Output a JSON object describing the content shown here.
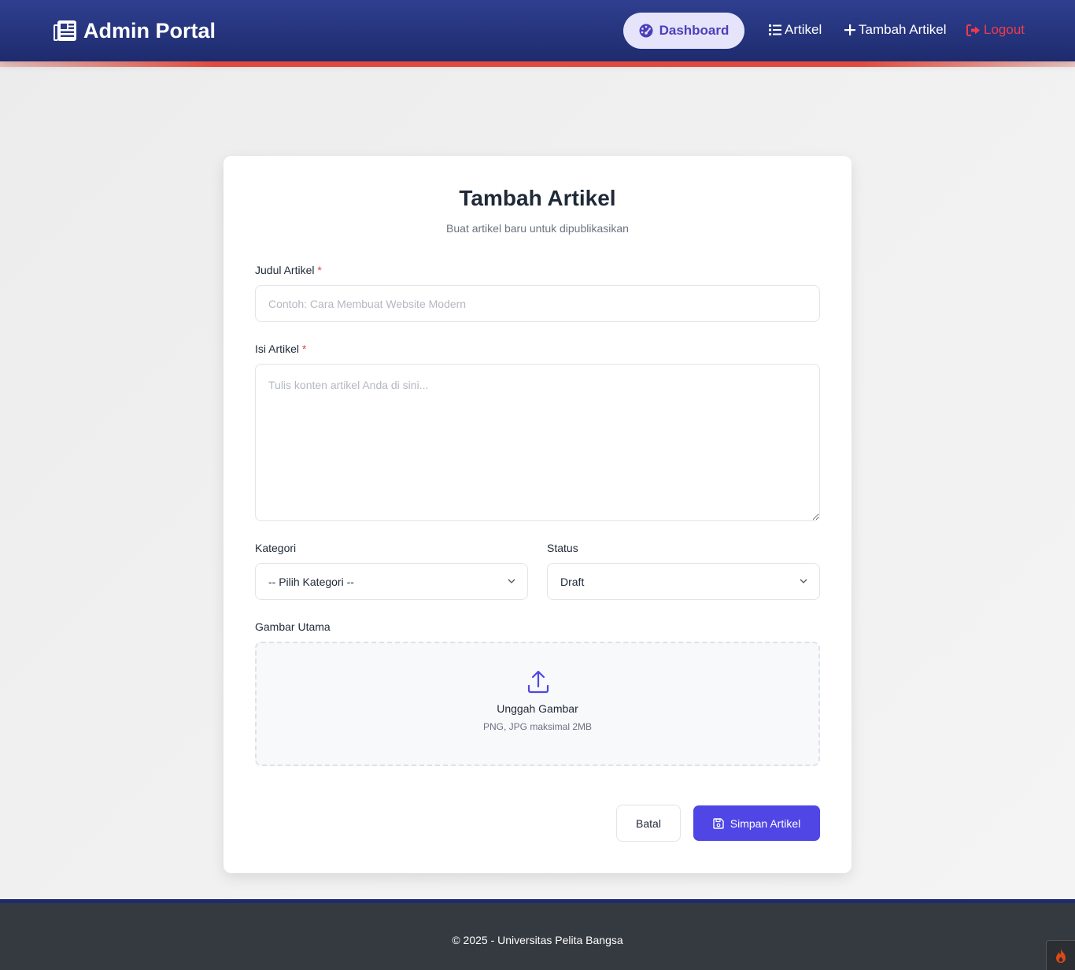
{
  "navbar": {
    "brand": "Admin Portal",
    "items": [
      {
        "label": "Dashboard",
        "icon": "gauge-icon"
      },
      {
        "label": "Artikel",
        "icon": "list-icon"
      },
      {
        "label": "Tambah Artikel",
        "icon": "plus-icon"
      },
      {
        "label": "Logout",
        "icon": "sign-out-icon"
      }
    ]
  },
  "form": {
    "title": "Tambah Artikel",
    "subtitle": "Buat artikel baru untuk dipublikasikan",
    "judul": {
      "label": "Judul Artikel",
      "required": "*",
      "placeholder": "Contoh: Cara Membuat Website Modern",
      "value": ""
    },
    "isi": {
      "label": "Isi Artikel",
      "required": "*",
      "placeholder": "Tulis konten artikel Anda di sini...",
      "value": ""
    },
    "kategori": {
      "label": "Kategori",
      "selected": "-- Pilih Kategori --"
    },
    "status": {
      "label": "Status",
      "selected": "Draft"
    },
    "gambar": {
      "label": "Gambar Utama",
      "upload_title": "Unggah Gambar",
      "upload_hint": "PNG, JPG maksimal 2MB"
    },
    "cancel_label": "Batal",
    "save_label": "Simpan Artikel"
  },
  "footer": {
    "text": "© 2025 - Universitas Pelita Bangsa"
  },
  "colors": {
    "navbar": "#1e2b6e",
    "accent": "#4f46e5",
    "danger": "#ef3b4b",
    "footer": "#343a40"
  }
}
